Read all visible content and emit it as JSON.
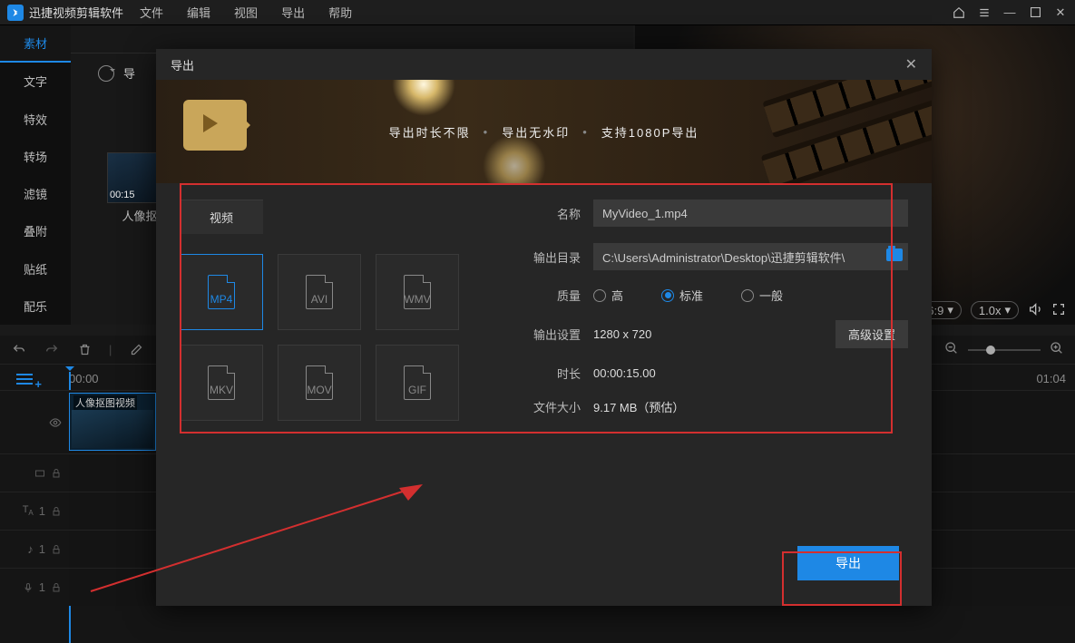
{
  "app": {
    "name": "迅捷视频剪辑软件"
  },
  "menubar": {
    "file": "文件",
    "edit": "编辑",
    "view": "视图",
    "export": "导出",
    "help": "帮助"
  },
  "sidebar": {
    "items": [
      "素材",
      "文字",
      "特效",
      "转场",
      "滤镜",
      "叠附",
      "贴纸",
      "配乐"
    ]
  },
  "mediapanel": {
    "import_prefix": "导",
    "clip_label": "人像抠",
    "clip_duration": "00:15"
  },
  "preview": {
    "aspect": "6:9",
    "speed": "1.0x"
  },
  "timeline": {
    "ruler": [
      "00:00",
      "01:04"
    ],
    "clip_label": "人像抠图视频",
    "track_text": "1"
  },
  "modal": {
    "title": "导出",
    "banner": {
      "t1": "导出时长不限",
      "t2": "导出无水印",
      "t3": "支持1080P导出"
    },
    "tab_video": "视频",
    "formats": [
      "MP4",
      "AVI",
      "WMV",
      "MKV",
      "MOV",
      "GIF"
    ],
    "labels": {
      "name": "名称",
      "outdir": "输出目录",
      "quality": "质量",
      "outset": "输出设置",
      "duration": "时长",
      "filesize": "文件大小",
      "advanced": "高级设置",
      "export": "导出"
    },
    "values": {
      "name": "MyVideo_1.mp4",
      "outdir": "C:\\Users\\Administrator\\Desktop\\迅捷剪辑软件\\",
      "outset": "1280 x 720",
      "duration": "00:00:15.00",
      "filesize": "9.17 MB（预估）"
    },
    "quality": {
      "high": "高",
      "standard": "标准",
      "normal": "一般"
    }
  }
}
